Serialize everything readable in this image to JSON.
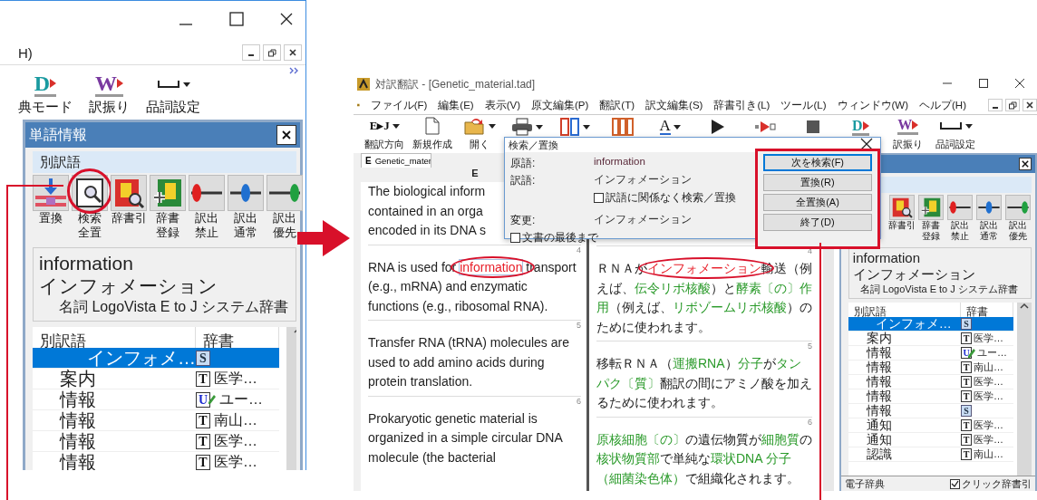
{
  "left_window": {
    "menu_fragment": "H)",
    "toolbar": [
      {
        "label": "典モード",
        "kind": "dict-mode",
        "icon_text": "D",
        "dropdown": false
      },
      {
        "label": "訳振り",
        "kind": "furigana",
        "icon_text": "W",
        "dropdown": false
      },
      {
        "label": "品詞設定",
        "kind": "pos",
        "dropdown": true
      }
    ],
    "word_panel": {
      "title": "単語情報",
      "section": "別訳語",
      "tools": [
        {
          "label": "置換",
          "kind": "replace",
          "circled": false
        },
        {
          "label": "検索全置",
          "kind": "search-replace",
          "circled": true
        },
        {
          "label": "辞書引",
          "kind": "lookup",
          "circled": false
        },
        {
          "label": "辞書登録",
          "kind": "register",
          "circled": false
        },
        {
          "label": "訳出禁止",
          "kind": "block",
          "circled": false
        },
        {
          "label": "訳出通常",
          "kind": "normal",
          "circled": false
        },
        {
          "label": "訳出優先",
          "kind": "prefer",
          "circled": false
        }
      ],
      "headword": "information",
      "translation": "インフォメーション",
      "info": "名詞  LogoVista E to J システム辞書",
      "columns": [
        "別訳語",
        "辞書"
      ],
      "rows": [
        {
          "word": "インフォメ…",
          "kind": "system",
          "badge": "S",
          "selected": true
        },
        {
          "word": "案内",
          "kind": "technical",
          "badge": "T",
          "dict": "医学…",
          "selected": false
        },
        {
          "word": "情報",
          "kind": "user",
          "badge": "U",
          "dict": "ユー…",
          "selected": false
        },
        {
          "word": "情報",
          "kind": "technical",
          "badge": "T",
          "dict": "南山…",
          "selected": false
        },
        {
          "word": "情報",
          "kind": "technical",
          "badge": "T",
          "dict": "医学…",
          "selected": false
        },
        {
          "word": "情報",
          "kind": "technical",
          "badge": "T",
          "dict": "医学…",
          "selected": false
        }
      ]
    }
  },
  "main_window": {
    "title": "対訳翻訳 - [Genetic_material.tad]",
    "menu": [
      "ファイル(F)",
      "編集(E)",
      "表示(V)",
      "原文編集(P)",
      "翻訳(T)",
      "訳文編集(S)",
      "辞書引き(L)",
      "ツール(L)",
      "ウィンドウ(W)",
      "ヘルプ(H)"
    ],
    "toolbar": [
      {
        "label": "翻訳方向",
        "kind": "direction",
        "icon_text": "E▸J",
        "dropdown": true
      },
      {
        "label": "新規作成",
        "kind": "new",
        "dropdown": false
      },
      {
        "label": "開く",
        "kind": "open",
        "dropdown": true
      },
      {
        "kind": "print",
        "dropdown": true
      },
      {
        "kind": "layout",
        "dropdown": true
      },
      {
        "kind": "columns",
        "dropdown": false
      },
      {
        "kind": "font",
        "icon_text": "A",
        "dropdown": true
      },
      {
        "kind": "play",
        "dropdown": false
      },
      {
        "kind": "step",
        "dropdown": false
      },
      {
        "kind": "stop",
        "dropdown": false
      },
      {
        "kind": "dict-mode",
        "icon_text": "D",
        "dropdown": false
      },
      {
        "label": "訳振り",
        "kind": "furigana",
        "icon_text": "W",
        "dropdown": false
      },
      {
        "label": "品詞設定",
        "kind": "pos",
        "dropdown": true
      }
    ],
    "tab": {
      "badge": "E",
      "label": "Genetic_mater"
    },
    "pane_header": "E",
    "segments": [
      {
        "source_lines": [
          "The biological inform",
          "contained in an orga",
          "encoded in its DNA s"
        ]
      },
      {
        "number_source": "4",
        "number_target": "4",
        "source": [
          {
            "text": "RNA is used for ",
            "kind": "plain"
          },
          {
            "text": "information",
            "kind": "hit"
          },
          {
            "text": " transport (e.g., mRNA) and enzymatic functions (e.g., ribosomal RNA).",
            "kind": "plain"
          }
        ],
        "target": [
          {
            "text": "ＲＮＡが",
            "kind": "plain"
          },
          {
            "text": "インフォメーション",
            "kind": "hit"
          },
          {
            "text": "輸送（例えば、",
            "kind": "plain"
          },
          {
            "text": "伝令リボ核酸",
            "kind": "term"
          },
          {
            "text": "）と",
            "kind": "plain"
          },
          {
            "text": "酵素〔の〕作用",
            "kind": "term"
          },
          {
            "text": "（例えば、",
            "kind": "plain"
          },
          {
            "text": "リボゾームリボ核酸",
            "kind": "term"
          },
          {
            "text": "）のために使われます。",
            "kind": "plain"
          }
        ]
      },
      {
        "number_source": "5",
        "number_target": "5",
        "source": [
          {
            "text": "Transfer RNA (tRNA) molecules are used to add amino acids during protein translation.",
            "kind": "plain"
          }
        ],
        "target": [
          {
            "text": "移転ＲＮＡ（",
            "kind": "plain"
          },
          {
            "text": "運搬RNA",
            "kind": "term"
          },
          {
            "text": "）",
            "kind": "plain"
          },
          {
            "text": "分子",
            "kind": "term"
          },
          {
            "text": "が",
            "kind": "plain"
          },
          {
            "text": "タンパク〔質〕",
            "kind": "term"
          },
          {
            "text": "翻訳の間にアミノ酸を加えるために使われます。",
            "kind": "plain"
          }
        ]
      },
      {
        "number_source": "6",
        "number_target": "6",
        "source": [
          {
            "text": "Prokaryotic genetic material is organized in a simple circular DNA molecule (the bacterial",
            "kind": "plain"
          }
        ],
        "target": [
          {
            "text": "原核細胞〔の〕",
            "kind": "term"
          },
          {
            "text": "の遺伝物質が",
            "kind": "plain"
          },
          {
            "text": "細胞質",
            "kind": "term"
          },
          {
            "text": "の",
            "kind": "plain"
          },
          {
            "text": "核状物質部",
            "kind": "term"
          },
          {
            "text": "で単純な",
            "kind": "plain"
          },
          {
            "text": "環状DNA 分子",
            "kind": "term"
          },
          {
            "text": "（細菌染色体）",
            "kind": "term"
          },
          {
            "text": "で組織化されます。",
            "kind": "plain"
          }
        ]
      }
    ],
    "dialog": {
      "title": "検索／置換",
      "source_label": "原語:",
      "source_value": "information",
      "target_label": "訳語:",
      "target_value": "インフォメーション",
      "ignore_option": {
        "label": "訳語に関係なく検索／置換",
        "checked": false
      },
      "change_label": "変更:",
      "change_value": "インフォメーション",
      "to_end_option": {
        "label": "文書の最後まで",
        "checked": false
      },
      "buttons": [
        {
          "label": "次を検索(F)",
          "default": true
        },
        {
          "label": "置換(R)",
          "default": false
        },
        {
          "label": "全置換(A)",
          "default": false
        },
        {
          "label": "終了(D)",
          "default": false
        }
      ],
      "buttons_outlined": true
    },
    "word_panel": {
      "tools": [
        {
          "label": "辞書引",
          "kind": "lookup",
          "circled": false
        },
        {
          "label": "辞書登録",
          "kind": "register",
          "circled": false
        },
        {
          "label": "訳出禁止",
          "kind": "block",
          "circled": false
        },
        {
          "label": "訳出通常",
          "kind": "normal",
          "circled": false
        },
        {
          "label": "訳出優先",
          "kind": "prefer",
          "circled": false
        }
      ],
      "headword": "information",
      "translation": "インフォメーション",
      "info": "名詞  LogoVista E to J システム辞書",
      "columns": [
        "別訳語",
        "辞書"
      ],
      "rows": [
        {
          "word": "インフォメ…",
          "kind": "system",
          "badge": "S",
          "selected": true
        },
        {
          "word": "案内",
          "kind": "technical",
          "badge": "T",
          "dict": "医学…",
          "selected": false
        },
        {
          "word": "情報",
          "kind": "user",
          "badge": "U",
          "dict": "ユー…",
          "selected": false
        },
        {
          "word": "情報",
          "kind": "technical",
          "badge": "T",
          "dict": "南山…",
          "selected": false
        },
        {
          "word": "情報",
          "kind": "technical",
          "badge": "T",
          "dict": "医学…",
          "selected": false
        },
        {
          "word": "情報",
          "kind": "technical",
          "badge": "T",
          "dict": "医学…",
          "selected": false
        },
        {
          "word": "情報",
          "kind": "system",
          "badge": "S",
          "selected": false
        },
        {
          "word": "通知",
          "kind": "technical",
          "badge": "T",
          "dict": "医学…",
          "selected": false
        },
        {
          "word": "通知",
          "kind": "technical",
          "badge": "T",
          "dict": "医学…",
          "selected": false
        },
        {
          "word": "認識",
          "kind": "technical",
          "badge": "T",
          "dict": "南山…",
          "selected": false
        }
      ],
      "status": "電子辞典",
      "click_option": {
        "label": "クリック辞書引",
        "checked": true
      }
    }
  }
}
